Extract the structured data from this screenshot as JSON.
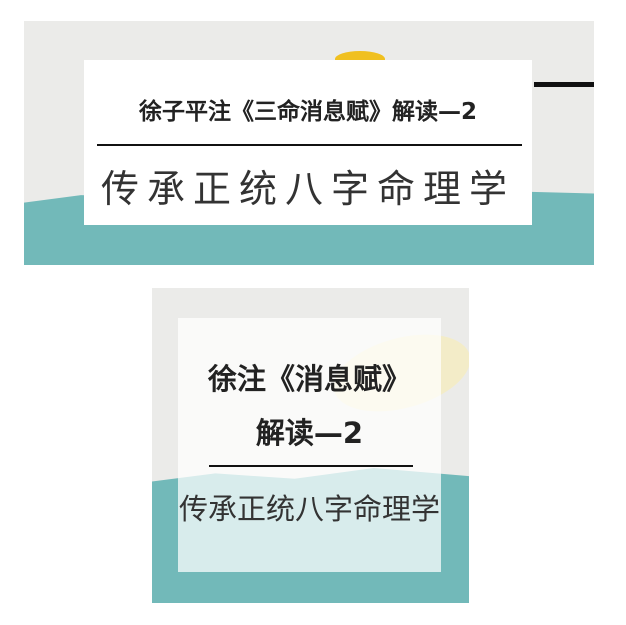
{
  "banner": {
    "title": "徐子平注《三命消息赋》解读—2",
    "subtitle": "传承正统八字命理学"
  },
  "square": {
    "title_line1": "徐注《消息赋》",
    "title_line2": "解读—2",
    "subtitle": "传承正统八字命理学"
  },
  "colors": {
    "teal": "#72b9b9",
    "yolk": "#f0c020",
    "background": "#ebebe9"
  }
}
